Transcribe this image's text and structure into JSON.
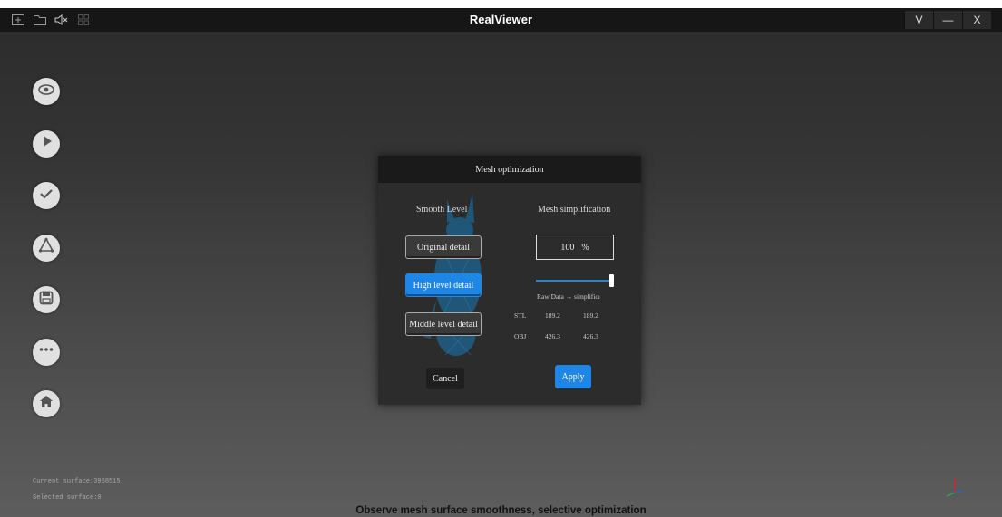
{
  "app": {
    "title": "RealViewer"
  },
  "titlebar": {
    "left_icons": [
      "add-icon",
      "folder-icon",
      "mute-icon",
      "grid-icon"
    ],
    "controls": {
      "menu": "V",
      "minimize": "—",
      "close": "X"
    }
  },
  "sidebar": {
    "items": [
      {
        "icon": "eye-icon"
      },
      {
        "icon": "play-icon"
      },
      {
        "icon": "check-icon"
      },
      {
        "icon": "mesh-icon"
      },
      {
        "icon": "save-icon"
      },
      {
        "icon": "more-icon"
      },
      {
        "icon": "home-icon"
      }
    ]
  },
  "dialog": {
    "title": "Mesh optimization",
    "smooth": {
      "heading": "Smooth Level",
      "options": [
        "Original detail",
        "High level detail",
        "Middle level detail"
      ],
      "selected": "High level detail"
    },
    "simplification": {
      "heading": "Mesh simplification",
      "value": "100",
      "unit": "%",
      "slider_fraction": 1.0,
      "table_header": "Raw Data → simplificı",
      "rows": [
        {
          "label": "STL",
          "raw": "189.2",
          "simplified": "189.2"
        },
        {
          "label": "OBJ",
          "raw": "426.3",
          "simplified": "426.3"
        }
      ]
    },
    "cancel_label": "Cancel",
    "apply_label": "Apply"
  },
  "status": {
    "current_surface": "Current surface:3968515",
    "selected_surface": "Selected surface:0"
  },
  "caption": "Observe mesh surface smoothness, selective optimization",
  "colors": {
    "accent": "#1e86e6",
    "titlebar": "#161616",
    "dialog": "#2c2c2c"
  }
}
